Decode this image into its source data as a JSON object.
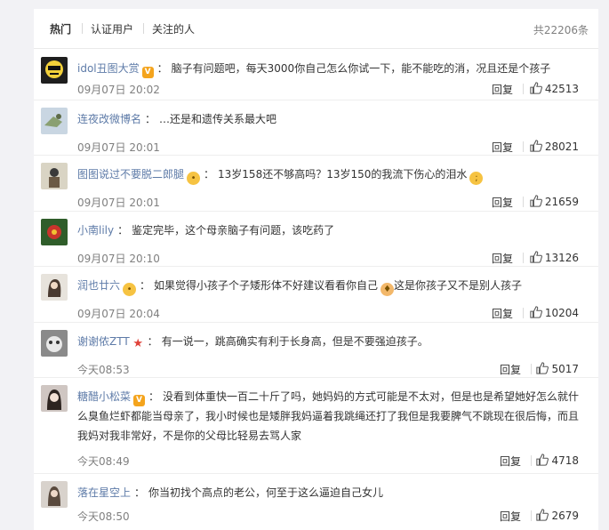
{
  "tabs": {
    "hot": "热门",
    "verified": "认证用户",
    "following": "关注的人"
  },
  "total_count": "共22206条",
  "actions": {
    "reply": "回复"
  },
  "comments": [
    {
      "user": "idol丑图大赏",
      "badge": "V",
      "badge_color": "#f4a41d",
      "text": "脑子有问题吧，每天3000你自己怎么你试一下，能不能吃的消，况且还是个孩子",
      "time": "09月07日 20:02",
      "likes": "42513"
    },
    {
      "user": "连夜改微博名",
      "text": "…还是和遗传关系最大吧",
      "time": "09月07日 20:01",
      "likes": "28021"
    },
    {
      "user": "图图说过不要脱二郎腿",
      "text": "13岁158还不够高吗？13岁150的我流下伤心的泪水",
      "time": "09月07日 20:01",
      "likes": "21659"
    },
    {
      "user": "小南lily",
      "text": "鉴定完毕，这个母亲脑子有问题，该吃药了",
      "time": "09月07日 20:10",
      "likes": "13126"
    },
    {
      "user": "润也廿六",
      "text": "如果觉得小孩子个子矮形体不好建议看看你自己",
      "text2": "这是你孩子又不是别人孩子",
      "time": "09月07日 20:04",
      "likes": "10204"
    },
    {
      "user": "谢谢侬ZTT",
      "badge": "★",
      "badge_color": "#e0423a",
      "text": "有一说一，跳高确实有利于长身高，但是不要强迫孩子。",
      "time": "今天08:53",
      "likes": "5017"
    },
    {
      "user": "糖醋小松菜",
      "badge": "V",
      "badge_color": "#f4a41d",
      "text": "没看到体重快一百二十斤了吗，她妈妈的方式可能是不太对，但是也是希望她好怎么就什么臭鱼烂虾都能当母亲了，我小时候也是矮胖我妈逼着我跳绳还打了我但是我要脾气不跳现在很后悔，而且我妈对我非常好，不是你的父母比轻易去骂人家",
      "time": "今天08:49",
      "likes": "4718"
    },
    {
      "user": "落在星空上",
      "text": "你当初找个高点的老公，何至于这么逼迫自己女儿",
      "time": "今天08:50",
      "likes": "2679"
    }
  ]
}
